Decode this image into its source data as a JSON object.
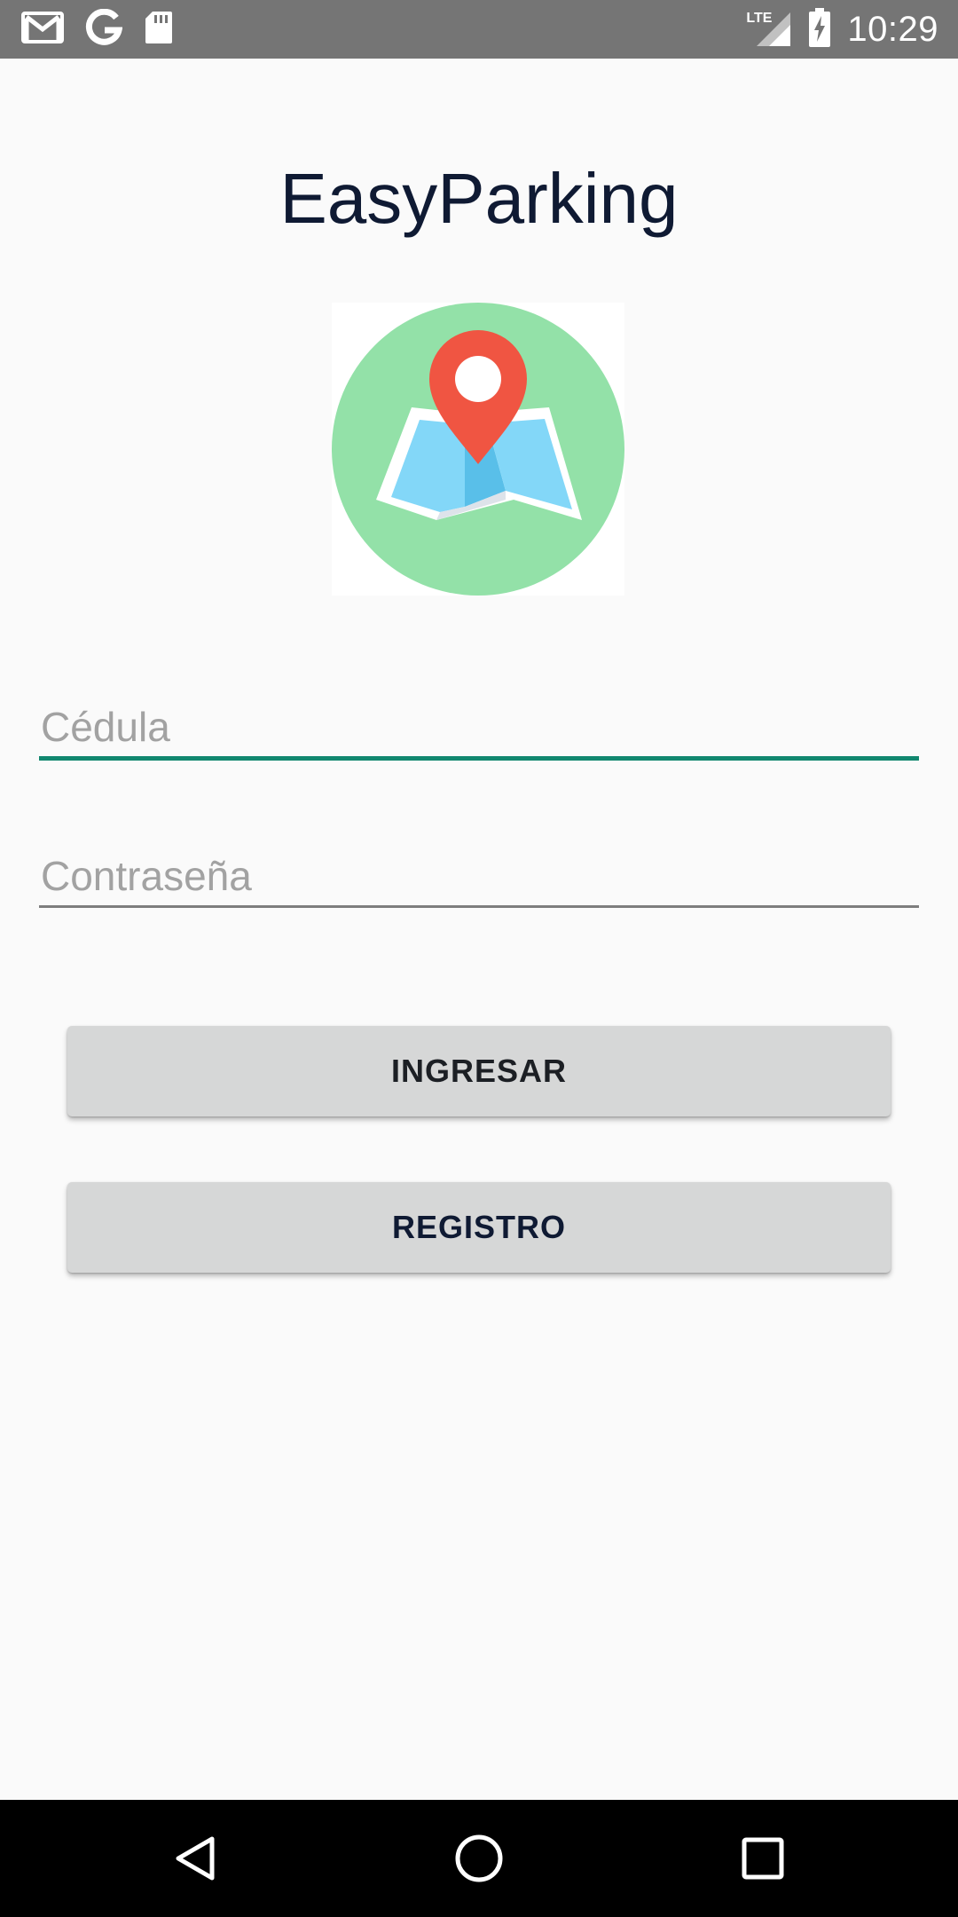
{
  "status_bar": {
    "time": "10:29",
    "network": "LTE",
    "icons": [
      "gmail-icon",
      "google-icon",
      "sd-card-icon",
      "lte-signal-icon",
      "battery-charging-icon"
    ]
  },
  "app": {
    "title": "EasyParking",
    "logo_icon": "map-location-pin-icon"
  },
  "form": {
    "cedula": {
      "placeholder": "Cédula",
      "value": ""
    },
    "password": {
      "placeholder": "Contraseña",
      "value": ""
    }
  },
  "buttons": {
    "login": "INGRESAR",
    "register": "REGISTRO"
  },
  "nav_bar": {
    "icons": [
      "back-icon",
      "home-icon",
      "recents-icon"
    ]
  },
  "colors": {
    "status_bar": "#757575",
    "accent": "#11876f",
    "title": "#0f1a33",
    "button": "#d6d7d7",
    "logo_circle": "#93e1a8",
    "pin": "#f05542"
  }
}
